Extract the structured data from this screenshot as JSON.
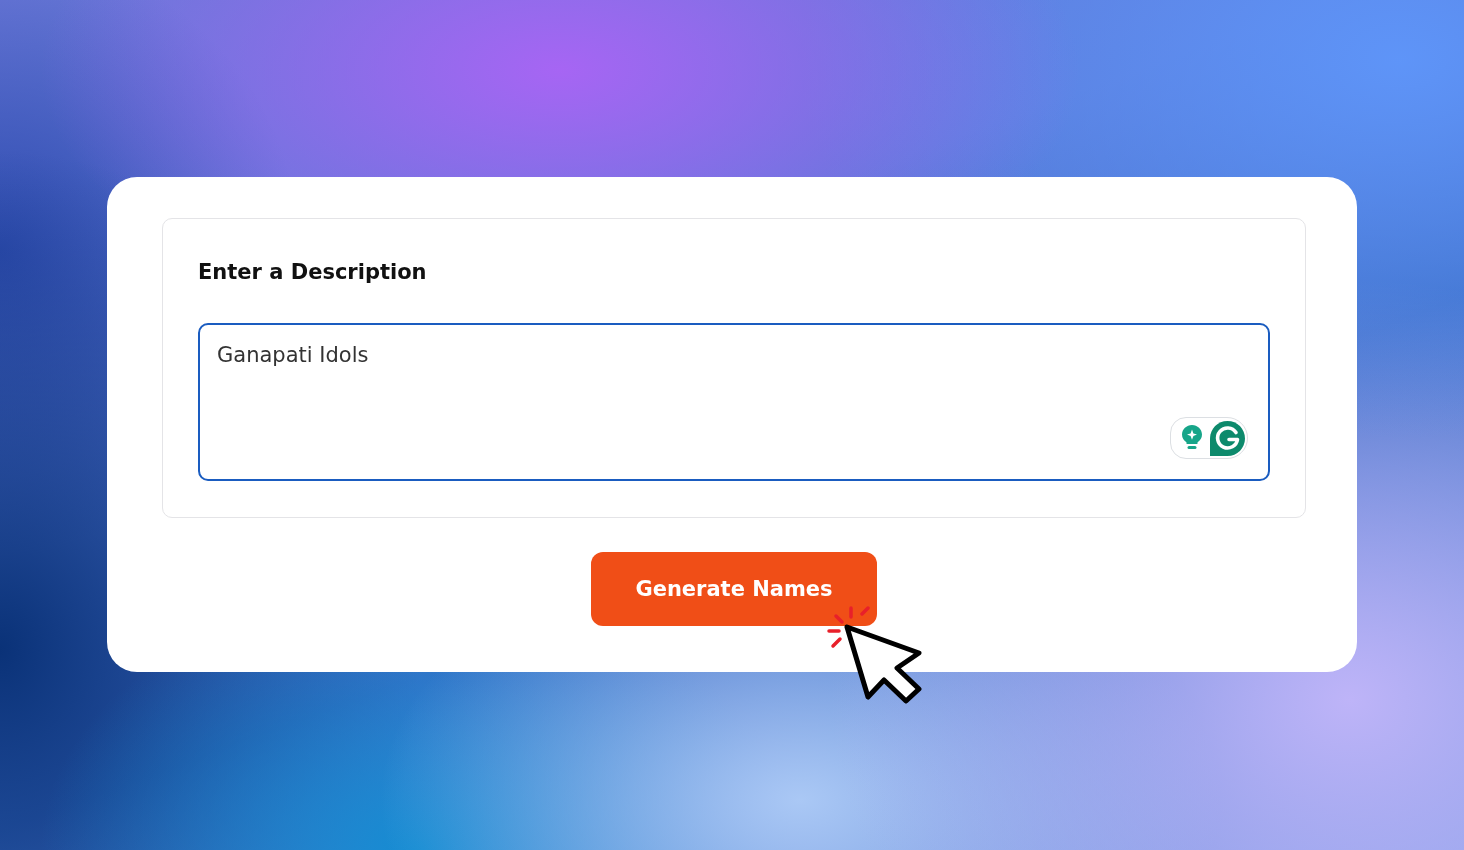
{
  "form": {
    "label": "Enter a Description",
    "description": {
      "value": "Ganapati Idols",
      "focused": true
    }
  },
  "button": {
    "label": "Generate Names"
  }
}
